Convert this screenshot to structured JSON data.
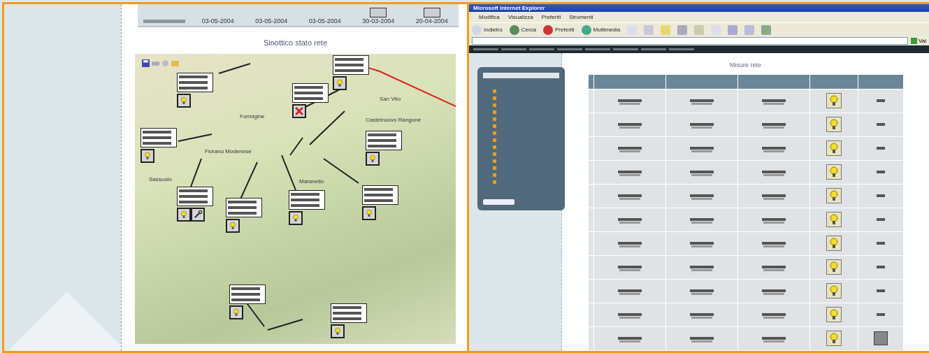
{
  "left_page": {
    "summary_row": [
      {
        "kind": "date",
        "text": "03-05-2004"
      },
      {
        "kind": "date",
        "text": "03-05-2004"
      },
      {
        "kind": "date",
        "text": "03-05-2004"
      },
      {
        "kind": "icon-date",
        "text": "30-03-2004"
      },
      {
        "kind": "icon-date",
        "text": "20-04-2004"
      }
    ],
    "title": "Sinottico stato rete",
    "map": {
      "places": [
        "Formigine",
        "Castelnuovo Rangone",
        "Fiorano Modenese",
        "Maranello",
        "Sassuolo",
        "San Vito"
      ],
      "stations": [
        {
          "kind": "bulb"
        },
        {
          "kind": "bulb"
        },
        {
          "kind": "cross"
        },
        {
          "kind": "bulb"
        },
        {
          "kind": "bulb"
        },
        {
          "kind": "bulb-tool"
        },
        {
          "kind": "bulb"
        },
        {
          "kind": "bulb"
        },
        {
          "kind": "bulb"
        },
        {
          "kind": "bulb"
        },
        {
          "kind": "bulb"
        }
      ]
    }
  },
  "browser": {
    "title": "Microsoft Internet Explorer",
    "menu": [
      "Modifica",
      "Visualizza",
      "Preferiti",
      "Strumenti"
    ],
    "toolbar": [
      "Indietro",
      "Cerca",
      "Preferiti",
      "Multimedia"
    ],
    "go": "Vai",
    "page_title": "Misure rete",
    "rows": [
      {
        "kind": "text"
      },
      {
        "kind": "text"
      },
      {
        "kind": "text"
      },
      {
        "kind": "text"
      },
      {
        "kind": "text"
      },
      {
        "kind": "text"
      },
      {
        "kind": "text"
      },
      {
        "kind": "text"
      },
      {
        "kind": "text"
      },
      {
        "kind": "text"
      },
      {
        "kind": "icon"
      }
    ]
  }
}
